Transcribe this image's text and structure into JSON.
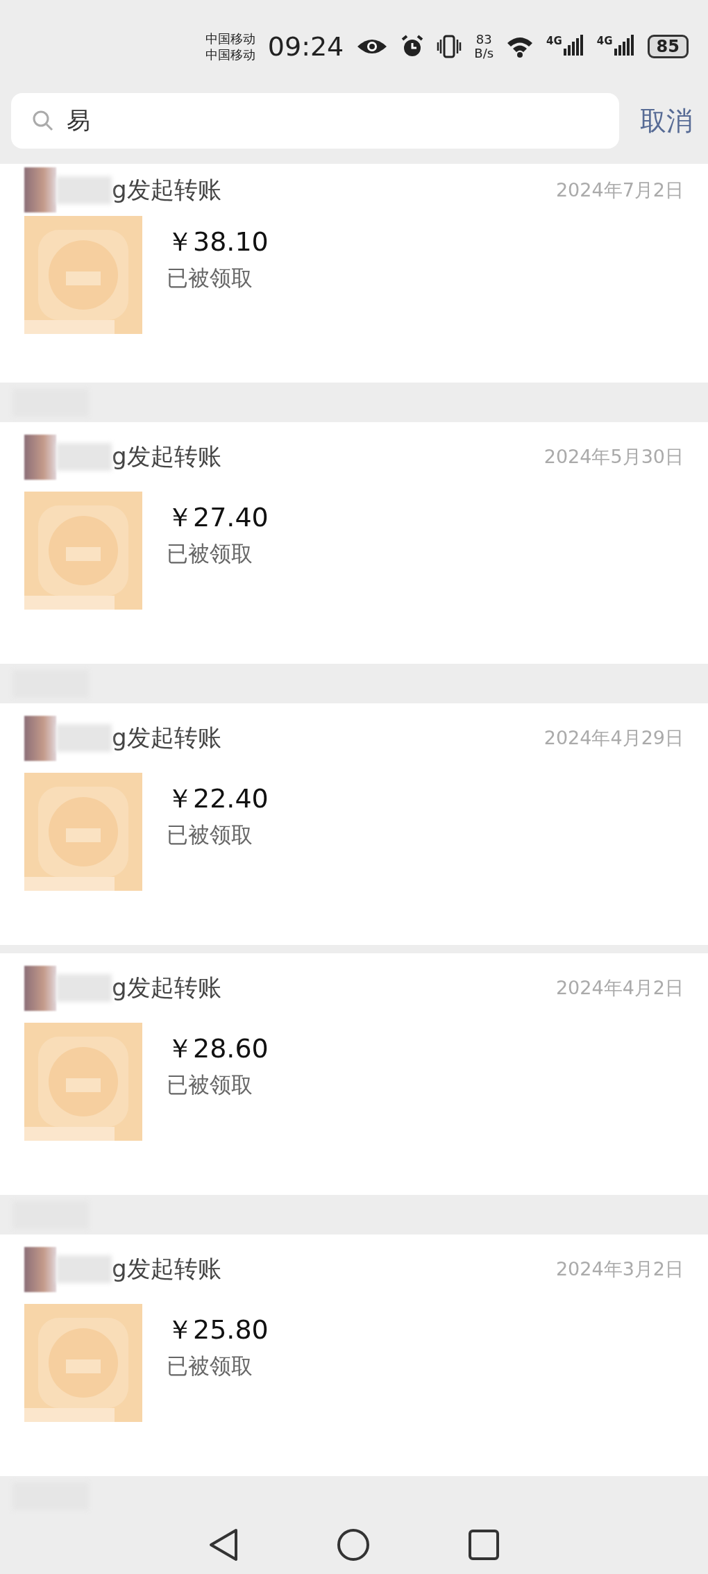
{
  "status_bar": {
    "carriers": [
      "中国移动",
      "中国移动"
    ],
    "time": "09:24",
    "speed": {
      "value": "83",
      "unit": "B/s"
    },
    "networks": [
      "4G",
      "4G"
    ],
    "battery": "85"
  },
  "search": {
    "value": "易",
    "cancel": "取消"
  },
  "items": [
    {
      "kind": "transfer",
      "title": "g发起转账",
      "date": "2024年7月2日",
      "amount": "￥38.10",
      "status": "已被领取"
    },
    {
      "kind": "header"
    },
    {
      "kind": "transfer",
      "title": "g发起转账",
      "date": "2024年5月30日",
      "amount": "￥27.40",
      "status": "已被领取"
    },
    {
      "kind": "header"
    },
    {
      "kind": "transfer",
      "title": "g发起转账",
      "date": "2024年4月29日",
      "amount": "￥22.40",
      "status": "已被领取"
    },
    {
      "kind": "gap"
    },
    {
      "kind": "transfer",
      "title": "g发起转账",
      "date": "2024年4月2日",
      "amount": "￥28.60",
      "status": "已被领取"
    },
    {
      "kind": "header"
    },
    {
      "kind": "transfer",
      "title": "g发起转账",
      "date": "2024年3月2日",
      "amount": "￥25.80",
      "status": "已被领取"
    },
    {
      "kind": "header"
    }
  ]
}
